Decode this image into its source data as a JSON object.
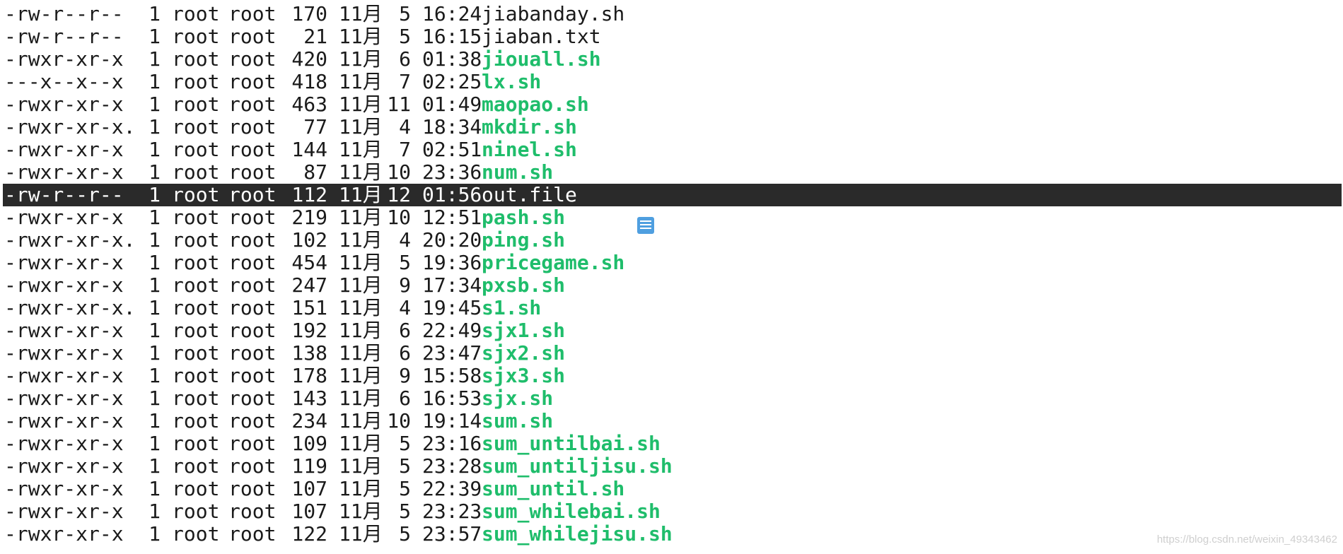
{
  "listing": [
    {
      "perm": "-rw-r--r--",
      "links": "1",
      "owner": "root",
      "group": "root",
      "size": "170",
      "month": "11月",
      "day": "5",
      "time": "16:24",
      "name": "jiabanday.sh",
      "exec": false
    },
    {
      "perm": "-rw-r--r--",
      "links": "1",
      "owner": "root",
      "group": "root",
      "size": "21",
      "month": "11月",
      "day": "5",
      "time": "16:15",
      "name": "jiaban.txt",
      "exec": false
    },
    {
      "perm": "-rwxr-xr-x",
      "links": "1",
      "owner": "root",
      "group": "root",
      "size": "420",
      "month": "11月",
      "day": "6",
      "time": "01:38",
      "name": "jiouall.sh",
      "exec": true
    },
    {
      "perm": "---x--x--x",
      "links": "1",
      "owner": "root",
      "group": "root",
      "size": "418",
      "month": "11月",
      "day": "7",
      "time": "02:25",
      "name": "lx.sh",
      "exec": true
    },
    {
      "perm": "-rwxr-xr-x",
      "links": "1",
      "owner": "root",
      "group": "root",
      "size": "463",
      "month": "11月",
      "day": "11",
      "time": "01:49",
      "name": "maopao.sh",
      "exec": true
    },
    {
      "perm": "-rwxr-xr-x.",
      "links": "1",
      "owner": "root",
      "group": "root",
      "size": "77",
      "month": "11月",
      "day": "4",
      "time": "18:34",
      "name": "mkdir.sh",
      "exec": true
    },
    {
      "perm": "-rwxr-xr-x",
      "links": "1",
      "owner": "root",
      "group": "root",
      "size": "144",
      "month": "11月",
      "day": "7",
      "time": "02:51",
      "name": "ninel.sh",
      "exec": true
    },
    {
      "perm": "-rwxr-xr-x",
      "links": "1",
      "owner": "root",
      "group": "root",
      "size": "87",
      "month": "11月",
      "day": "10",
      "time": "23:36",
      "name": "num.sh",
      "exec": true
    },
    {
      "perm": "-rw-r--r--",
      "links": "1",
      "owner": "root",
      "group": "root",
      "size": "112",
      "month": "11月",
      "day": "12",
      "time": "01:56",
      "name": "out.file",
      "exec": false,
      "selected": true
    },
    {
      "perm": "-rwxr-xr-x",
      "links": "1",
      "owner": "root",
      "group": "root",
      "size": "219",
      "month": "11月",
      "day": "10",
      "time": "12:51",
      "name": "pash.sh",
      "exec": true
    },
    {
      "perm": "-rwxr-xr-x.",
      "links": "1",
      "owner": "root",
      "group": "root",
      "size": "102",
      "month": "11月",
      "day": "4",
      "time": "20:20",
      "name": "ping.sh",
      "exec": true
    },
    {
      "perm": "-rwxr-xr-x",
      "links": "1",
      "owner": "root",
      "group": "root",
      "size": "454",
      "month": "11月",
      "day": "5",
      "time": "19:36",
      "name": "pricegame.sh",
      "exec": true
    },
    {
      "perm": "-rwxr-xr-x",
      "links": "1",
      "owner": "root",
      "group": "root",
      "size": "247",
      "month": "11月",
      "day": "9",
      "time": "17:34",
      "name": "pxsb.sh",
      "exec": true
    },
    {
      "perm": "-rwxr-xr-x.",
      "links": "1",
      "owner": "root",
      "group": "root",
      "size": "151",
      "month": "11月",
      "day": "4",
      "time": "19:45",
      "name": "s1.sh",
      "exec": true
    },
    {
      "perm": "-rwxr-xr-x",
      "links": "1",
      "owner": "root",
      "group": "root",
      "size": "192",
      "month": "11月",
      "day": "6",
      "time": "22:49",
      "name": "sjx1.sh",
      "exec": true
    },
    {
      "perm": "-rwxr-xr-x",
      "links": "1",
      "owner": "root",
      "group": "root",
      "size": "138",
      "month": "11月",
      "day": "6",
      "time": "23:47",
      "name": "sjx2.sh",
      "exec": true
    },
    {
      "perm": "-rwxr-xr-x",
      "links": "1",
      "owner": "root",
      "group": "root",
      "size": "178",
      "month": "11月",
      "day": "9",
      "time": "15:58",
      "name": "sjx3.sh",
      "exec": true
    },
    {
      "perm": "-rwxr-xr-x",
      "links": "1",
      "owner": "root",
      "group": "root",
      "size": "143",
      "month": "11月",
      "day": "6",
      "time": "16:53",
      "name": "sjx.sh",
      "exec": true
    },
    {
      "perm": "-rwxr-xr-x",
      "links": "1",
      "owner": "root",
      "group": "root",
      "size": "234",
      "month": "11月",
      "day": "10",
      "time": "19:14",
      "name": "sum.sh",
      "exec": true
    },
    {
      "perm": "-rwxr-xr-x",
      "links": "1",
      "owner": "root",
      "group": "root",
      "size": "109",
      "month": "11月",
      "day": "5",
      "time": "23:16",
      "name": "sum_untilbai.sh",
      "exec": true
    },
    {
      "perm": "-rwxr-xr-x",
      "links": "1",
      "owner": "root",
      "group": "root",
      "size": "119",
      "month": "11月",
      "day": "5",
      "time": "23:28",
      "name": "sum_untiljisu.sh",
      "exec": true
    },
    {
      "perm": "-rwxr-xr-x",
      "links": "1",
      "owner": "root",
      "group": "root",
      "size": "107",
      "month": "11月",
      "day": "5",
      "time": "22:39",
      "name": "sum_until.sh",
      "exec": true
    },
    {
      "perm": "-rwxr-xr-x",
      "links": "1",
      "owner": "root",
      "group": "root",
      "size": "107",
      "month": "11月",
      "day": "5",
      "time": "23:23",
      "name": "sum_whilebai.sh",
      "exec": true
    },
    {
      "perm": "-rwxr-xr-x",
      "links": "1",
      "owner": "root",
      "group": "root",
      "size": "122",
      "month": "11月",
      "day": "5",
      "time": "23:57",
      "name": "sum_whilejisu.sh",
      "exec": true
    }
  ],
  "colors": {
    "executable": "#1fbd6b",
    "highlight_bg": "#2a2a2a",
    "text": "#1a1a1a",
    "note_icon": "#4f9fe0"
  },
  "icons": {
    "floating_note": "note-icon"
  },
  "watermark": "https://blog.csdn.net/weixin_49343462"
}
